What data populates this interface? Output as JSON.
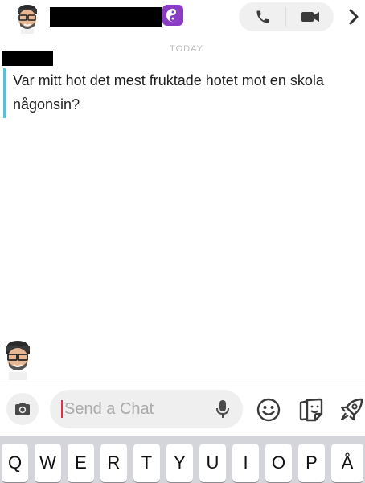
{
  "header": {
    "contact_avatar": "bitmoji-avatar",
    "contact_name_redacted": true,
    "status_icon": "yin-yang-icon",
    "call_icon": "phone-icon",
    "video_icon": "video-camera-icon",
    "more_icon": "chevron-right-icon"
  },
  "chat": {
    "date_label": "TODAY",
    "messages": [
      {
        "sender_redacted": true,
        "text": "Var mitt hot det mest fruktade hotet mot en skola någonsin?",
        "accent_color": "#58bfd6"
      }
    ]
  },
  "composer": {
    "camera_icon": "camera-icon",
    "placeholder": "Send a Chat",
    "value": "",
    "mic_icon": "microphone-icon",
    "emoji_icon": "smiley-icon",
    "sticker_icon": "sticker-icon",
    "games_icon": "rocket-icon",
    "caret_color": "#e0304a"
  },
  "keyboard": {
    "row1": [
      "Q",
      "W",
      "E",
      "R",
      "T",
      "Y",
      "U",
      "I",
      "O",
      "P",
      "Å"
    ]
  }
}
